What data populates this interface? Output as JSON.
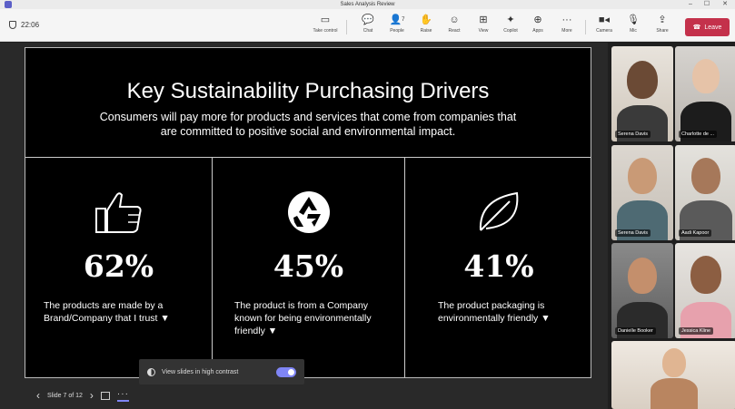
{
  "window": {
    "title": "Sales Analysis Review"
  },
  "meeting": {
    "timer": "22:06"
  },
  "toolbar": {
    "items": [
      {
        "label": "Take control",
        "icon": "take-control-icon"
      },
      {
        "label": "Chat",
        "icon": "chat-icon"
      },
      {
        "label": "People",
        "icon": "people-icon",
        "badge": "7"
      },
      {
        "label": "Raise",
        "icon": "raise-hand-icon"
      },
      {
        "label": "React",
        "icon": "react-icon"
      },
      {
        "label": "View",
        "icon": "view-icon"
      },
      {
        "label": "Copilot",
        "icon": "copilot-icon"
      },
      {
        "label": "Apps",
        "icon": "apps-icon"
      },
      {
        "label": "More",
        "icon": "more-icon"
      },
      {
        "label": "Camera",
        "icon": "camera-icon"
      },
      {
        "label": "Mic",
        "icon": "mic-icon"
      },
      {
        "label": "Share",
        "icon": "share-icon"
      }
    ],
    "leave_label": "Leave",
    "leave_color": "#c4314b"
  },
  "slide": {
    "title": "Key Sustainability Purchasing Drivers",
    "subtitle": "Consumers will pay more for products and services that come from companies that are committed to positive social and environmental impact.",
    "stats": [
      {
        "icon": "thumbs-up-icon",
        "value": "62%",
        "desc_line1": "The products are made by a",
        "desc_line2": "Brand/Company that I trust ▼",
        "desc_line3": ""
      },
      {
        "icon": "recycle-icon",
        "value": "45%",
        "desc_line1": "The product is from a Company",
        "desc_line2": "known for being environmentally",
        "desc_line3": "friendly  ▼"
      },
      {
        "icon": "leaf-icon",
        "value": "41%",
        "desc_line1": "The product packaging is",
        "desc_line2": "environmentally friendly ▼",
        "desc_line3": ""
      }
    ]
  },
  "presenter": {
    "high_contrast_label": "View slides in high contrast",
    "high_contrast_on": true,
    "slide_counter": "Slide 7 of 12",
    "accent": "#7f85f5"
  },
  "participants": [
    {
      "name": "Serena Davis"
    },
    {
      "name": "Charlotte de ..."
    },
    {
      "name": "Serena Davis"
    },
    {
      "name": "Aadi Kapoor"
    },
    {
      "name": "Danielle Booker"
    },
    {
      "name": "Jessica Kline"
    },
    {
      "name": ""
    }
  ]
}
